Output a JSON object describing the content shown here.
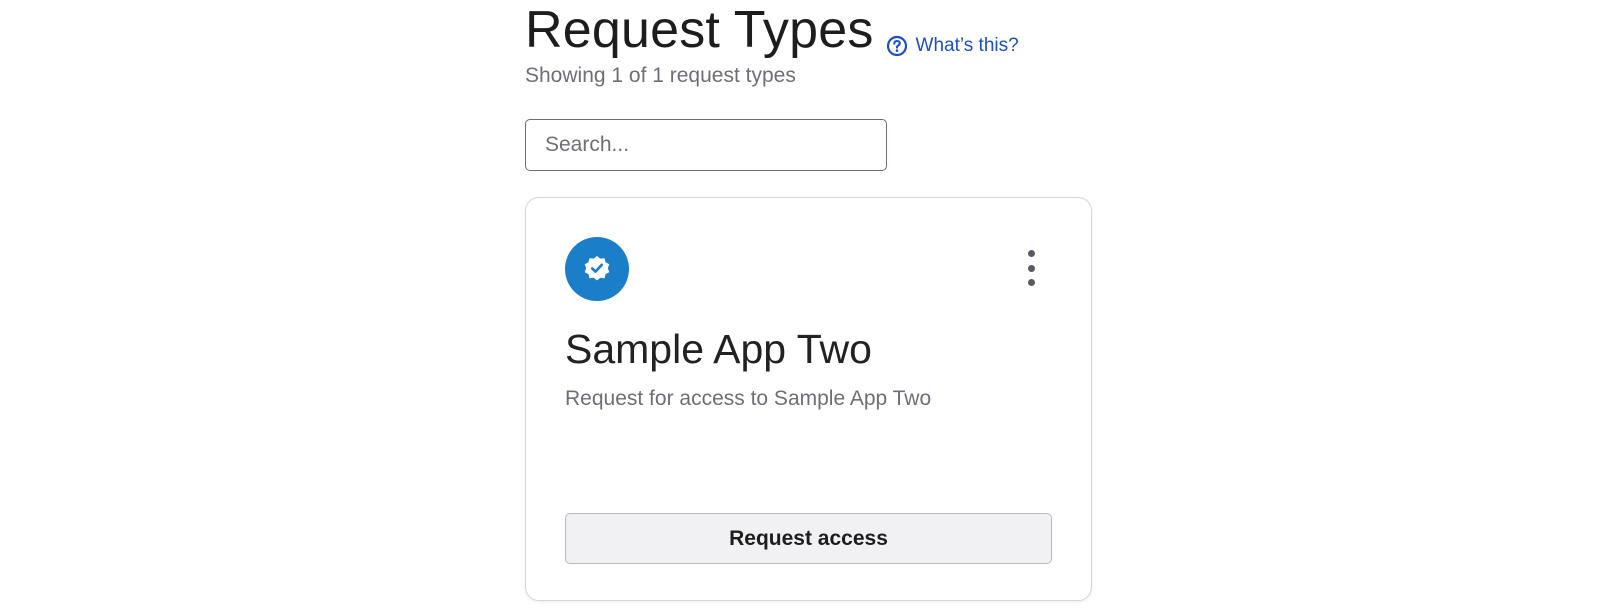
{
  "header": {
    "title": "Request Types",
    "help_link_label": "What’s this?",
    "subtitle": "Showing 1 of 1 request types"
  },
  "search": {
    "placeholder": "Search...",
    "value": ""
  },
  "cards": [
    {
      "icon": "verified-badge-icon",
      "title": "Sample App Two",
      "description": "Request for access to Sample App Two",
      "action_label": "Request access"
    }
  ],
  "colors": {
    "accent_link": "#1c4fc4",
    "app_icon_bg": "#1a7ec8"
  }
}
